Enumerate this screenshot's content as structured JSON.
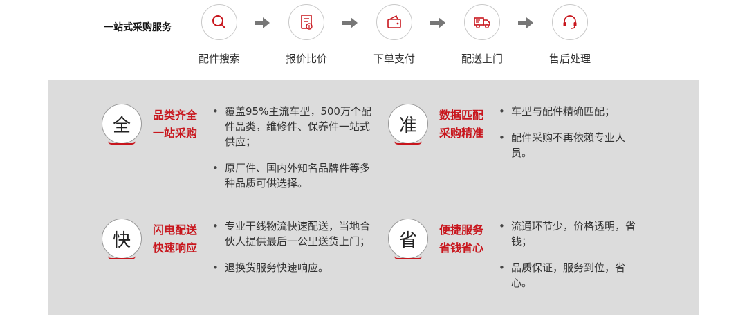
{
  "flow": {
    "title": "一站式采购服务",
    "steps": [
      {
        "label": "配件搜索",
        "icon": "search-icon"
      },
      {
        "label": "报价比价",
        "icon": "quote-document-icon"
      },
      {
        "label": "下单支付",
        "icon": "wallet-icon"
      },
      {
        "label": "配送上门",
        "icon": "delivery-truck-icon"
      },
      {
        "label": "售后处理",
        "icon": "headset-icon"
      }
    ],
    "arrow_icon": "right-arrow-icon"
  },
  "features": [
    {
      "char": "全",
      "title_line1": "品类齐全",
      "title_line2": "一站采购",
      "bullets": [
        "覆盖95%主流车型，500万个配件品类，维修件、保养件一站式供应；",
        "原厂件、国内外知名品牌件等多种品质可供选择。"
      ]
    },
    {
      "char": "准",
      "title_line1": "数据匹配",
      "title_line2": "采购精准",
      "bullets": [
        "车型与配件精确匹配；",
        "配件采购不再依赖专业人员。"
      ]
    },
    {
      "char": "快",
      "title_line1": "闪电配送",
      "title_line2": "快速响应",
      "bullets": [
        "专业干线物流快速配送，当地合伙人提供最后一公里送货上门；",
        "退换货服务快速响应。"
      ]
    },
    {
      "char": "省",
      "title_line1": "便捷服务",
      "title_line2": "省钱省心",
      "bullets": [
        "流通环节少，价格透明，省钱；",
        "品质保证，服务到位，省心。"
      ]
    }
  ],
  "colors": {
    "accent": "#c8161d",
    "panel_bg": "#dcdcdc",
    "arrow": "#777777"
  }
}
